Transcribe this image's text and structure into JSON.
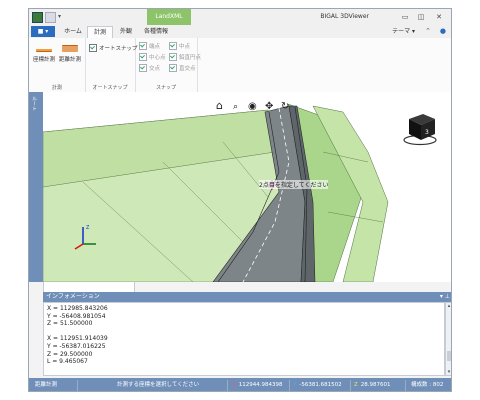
{
  "window": {
    "title": "BIGAL 3DViewer",
    "context_tab": "LandXML"
  },
  "ribbon": {
    "file_tab": "■ ▾",
    "tabs": [
      "ホーム",
      "計測",
      "外観",
      "各種情報"
    ],
    "active_tab": "計測",
    "theme_menu": "テーマ ▾",
    "measure_group": {
      "label": "計測",
      "buttons": [
        "座標計測",
        "距離計測"
      ]
    },
    "autosnap_group": {
      "label": "オートスナップ",
      "checkbox": "オートスナップ",
      "checked": true
    },
    "snap_group": {
      "label": "スナップ",
      "items": [
        "端点",
        "中点",
        "中心点",
        "鉛直円点",
        "交点",
        "直交点"
      ]
    }
  },
  "viewer": {
    "side_label": "ルート",
    "hint": "2点目を指定してください",
    "cube_face": "3"
  },
  "info_panel": {
    "title": "インフォメーション",
    "lines": [
      "X = 112985.843206",
      "Y = -56408.981054",
      "Z = 51.500000",
      "",
      "X = 112951.914039",
      "Y = -56387.016225",
      "Z = 29.500000",
      "L = 9.465067"
    ]
  },
  "status_bar": {
    "mode": "距離計測",
    "message": "計測する座標を選択してください",
    "x_label": "X",
    "x_value": "112944.984398",
    "y_label": "Y",
    "y_value": "-56381.681502",
    "z_label": "Z",
    "z_value": "28.987601",
    "element_count": "構成数 : 802"
  },
  "colors": {
    "accent_blue": "#6f8fb8",
    "file_tab": "#2b6cbf",
    "context_tab": "#8dc46a",
    "road_green": "#9fcf7c"
  }
}
